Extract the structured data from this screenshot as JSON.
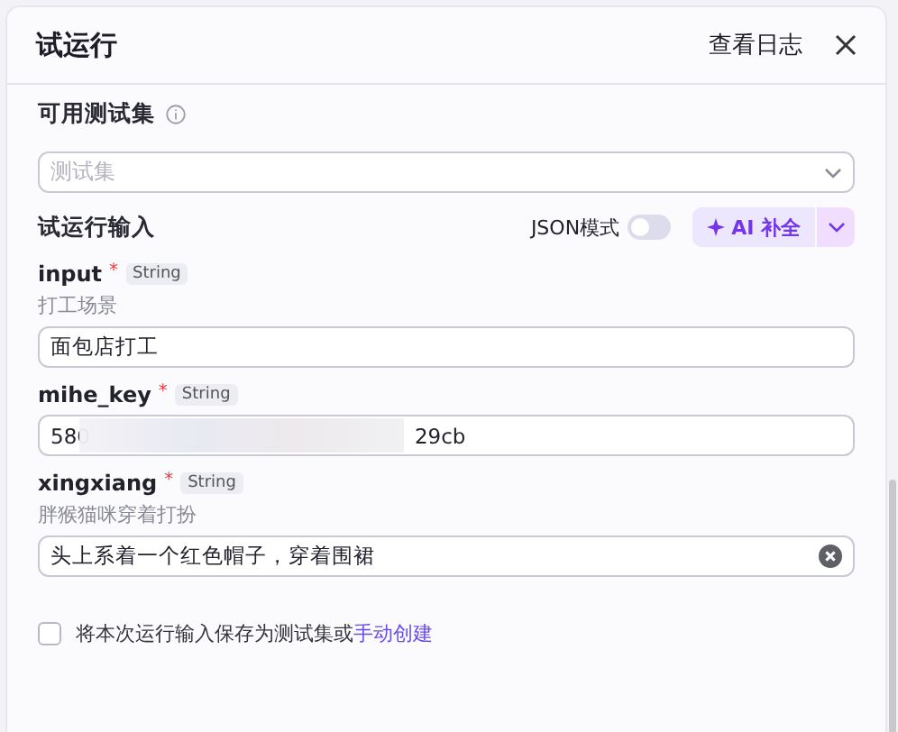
{
  "header": {
    "title": "试运行",
    "log_link": "查看日志"
  },
  "test_set": {
    "label": "可用测试集",
    "placeholder": "测试集"
  },
  "run_input": {
    "label": "试运行输入",
    "json_mode": {
      "label": "JSON模式",
      "on": false
    },
    "ai_button": "AI 补全"
  },
  "fields": [
    {
      "kind": "text",
      "name": "input",
      "required_mark": "*",
      "type": "String",
      "description": "打工场景",
      "value": "面包店打工"
    },
    {
      "kind": "redacted",
      "name": "mihe_key",
      "required_mark": "*",
      "type": "String",
      "value": "580",
      "value_end": "29cb"
    },
    {
      "kind": "clearable",
      "name": "xingxiang",
      "required_mark": "*",
      "type": "String",
      "description": "胖猴猫咪穿着打扮",
      "value": "头上系着一个红色帽子，穿着围裙"
    }
  ],
  "save": {
    "checked": false,
    "text": "将本次运行输入保存为测试集或",
    "link": "手动创建"
  }
}
